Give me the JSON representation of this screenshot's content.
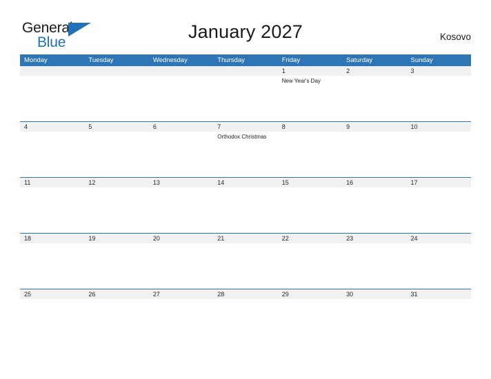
{
  "brand": {
    "name_part1": "General",
    "name_part2": "Blue",
    "triangle_icon": "triangle-icon",
    "accent_color": "#1F72B8"
  },
  "header": {
    "title": "January 2027",
    "country": "Kosovo"
  },
  "colors": {
    "header_blue": "#2E75B6",
    "date_strip_gray": "#F1F1F1",
    "page_background": "#FEFEFE",
    "text_dark": "#1A1A1A"
  },
  "calendar": {
    "weekdays": [
      "Monday",
      "Tuesday",
      "Wednesday",
      "Thursday",
      "Friday",
      "Saturday",
      "Sunday"
    ],
    "weeks": [
      {
        "days": [
          {
            "date": "",
            "events": []
          },
          {
            "date": "",
            "events": []
          },
          {
            "date": "",
            "events": []
          },
          {
            "date": "",
            "events": []
          },
          {
            "date": "1",
            "events": [
              "New Year's Day"
            ]
          },
          {
            "date": "2",
            "events": []
          },
          {
            "date": "3",
            "events": []
          }
        ]
      },
      {
        "days": [
          {
            "date": "4",
            "events": []
          },
          {
            "date": "5",
            "events": []
          },
          {
            "date": "6",
            "events": []
          },
          {
            "date": "7",
            "events": [
              "Orthodox Christmas"
            ]
          },
          {
            "date": "8",
            "events": []
          },
          {
            "date": "9",
            "events": []
          },
          {
            "date": "10",
            "events": []
          }
        ]
      },
      {
        "days": [
          {
            "date": "11",
            "events": []
          },
          {
            "date": "12",
            "events": []
          },
          {
            "date": "13",
            "events": []
          },
          {
            "date": "14",
            "events": []
          },
          {
            "date": "15",
            "events": []
          },
          {
            "date": "16",
            "events": []
          },
          {
            "date": "17",
            "events": []
          }
        ]
      },
      {
        "days": [
          {
            "date": "18",
            "events": []
          },
          {
            "date": "19",
            "events": []
          },
          {
            "date": "20",
            "events": []
          },
          {
            "date": "21",
            "events": []
          },
          {
            "date": "22",
            "events": []
          },
          {
            "date": "23",
            "events": []
          },
          {
            "date": "24",
            "events": []
          }
        ]
      },
      {
        "days": [
          {
            "date": "25",
            "events": []
          },
          {
            "date": "26",
            "events": []
          },
          {
            "date": "27",
            "events": []
          },
          {
            "date": "28",
            "events": []
          },
          {
            "date": "29",
            "events": []
          },
          {
            "date": "30",
            "events": []
          },
          {
            "date": "31",
            "events": []
          }
        ]
      }
    ]
  }
}
